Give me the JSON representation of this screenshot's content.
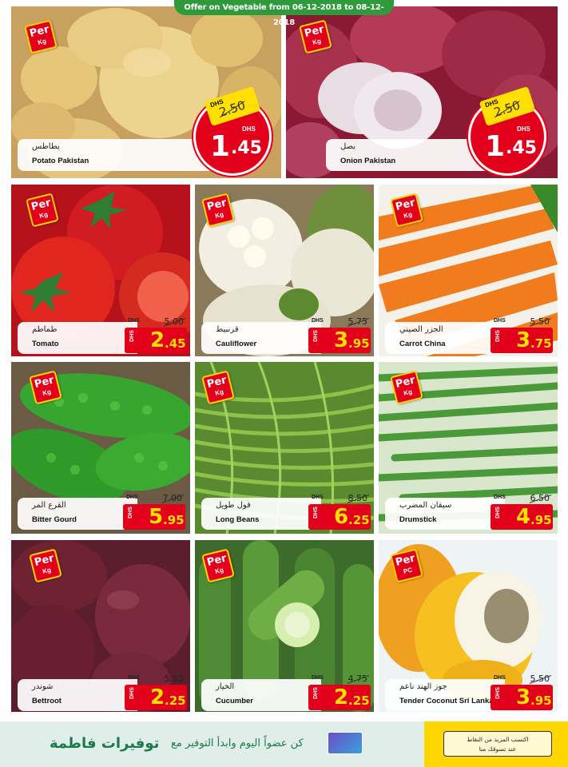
{
  "header": {
    "offer_text": "Offer on Vegetable from 06-12-2018 to 08-12-2018"
  },
  "common": {
    "per": "Per",
    "kg": "Kg",
    "pc": "PC",
    "dhs": "DHS"
  },
  "hero": [
    {
      "ar": "بطاطس",
      "en": "Potato Pakistan",
      "old": "2.50",
      "int": "1",
      "dec": ".45",
      "unit": "Kg"
    },
    {
      "ar": "بصل",
      "en": "Onion Pakistan",
      "old": "2.50",
      "int": "1",
      "dec": ".45",
      "unit": "Kg"
    }
  ],
  "products": [
    {
      "ar": "طماطم",
      "en": "Tomato",
      "old": "5.00",
      "int": "2",
      "dec": ".45",
      "unit": "Kg"
    },
    {
      "ar": "قرنبيط",
      "en": "Cauliflower",
      "old": "5.75",
      "int": "3",
      "dec": ".95",
      "unit": "Kg"
    },
    {
      "ar": "الجزر الصيني",
      "en": "Carrot China",
      "old": "5.50",
      "int": "3",
      "dec": ".75",
      "unit": "Kg"
    },
    {
      "ar": "القرع المر",
      "en": "Bitter Gourd",
      "old": "7.00",
      "int": "5",
      "dec": ".95",
      "unit": "Kg"
    },
    {
      "ar": "فول طويل",
      "en": "Long Beans",
      "old": "8.50",
      "int": "6",
      "dec": ".25",
      "unit": "Kg"
    },
    {
      "ar": "سيقان المضرب",
      "en": "Drumstick",
      "old": "6.50",
      "int": "4",
      "dec": ".95",
      "unit": "Kg"
    },
    {
      "ar": "شوندر",
      "en": "Bettroot",
      "old": "5.95",
      "int": "2",
      "dec": ".25",
      "unit": "Kg"
    },
    {
      "ar": "الخيار",
      "en": "Cucumber",
      "old": "4.75",
      "int": "2",
      "dec": ".25",
      "unit": "Kg"
    },
    {
      "ar": "جوز الهند ناعم",
      "en": "Tender Coconut Sri Lanka",
      "old": "5.50",
      "int": "3",
      "dec": ".95",
      "unit": "PC"
    }
  ],
  "footer": {
    "brand": "توفيرات فاطمة",
    "slogan": "كن عضواً اليوم وابدأ التوفير مع",
    "stores_line1": "اكتسب المزيد من النقاط",
    "stores_line2": "عند تسوقك منا"
  },
  "colors": {
    "red": "#e3001b",
    "yellow": "#ffe000",
    "green": "#2f9a3c"
  }
}
